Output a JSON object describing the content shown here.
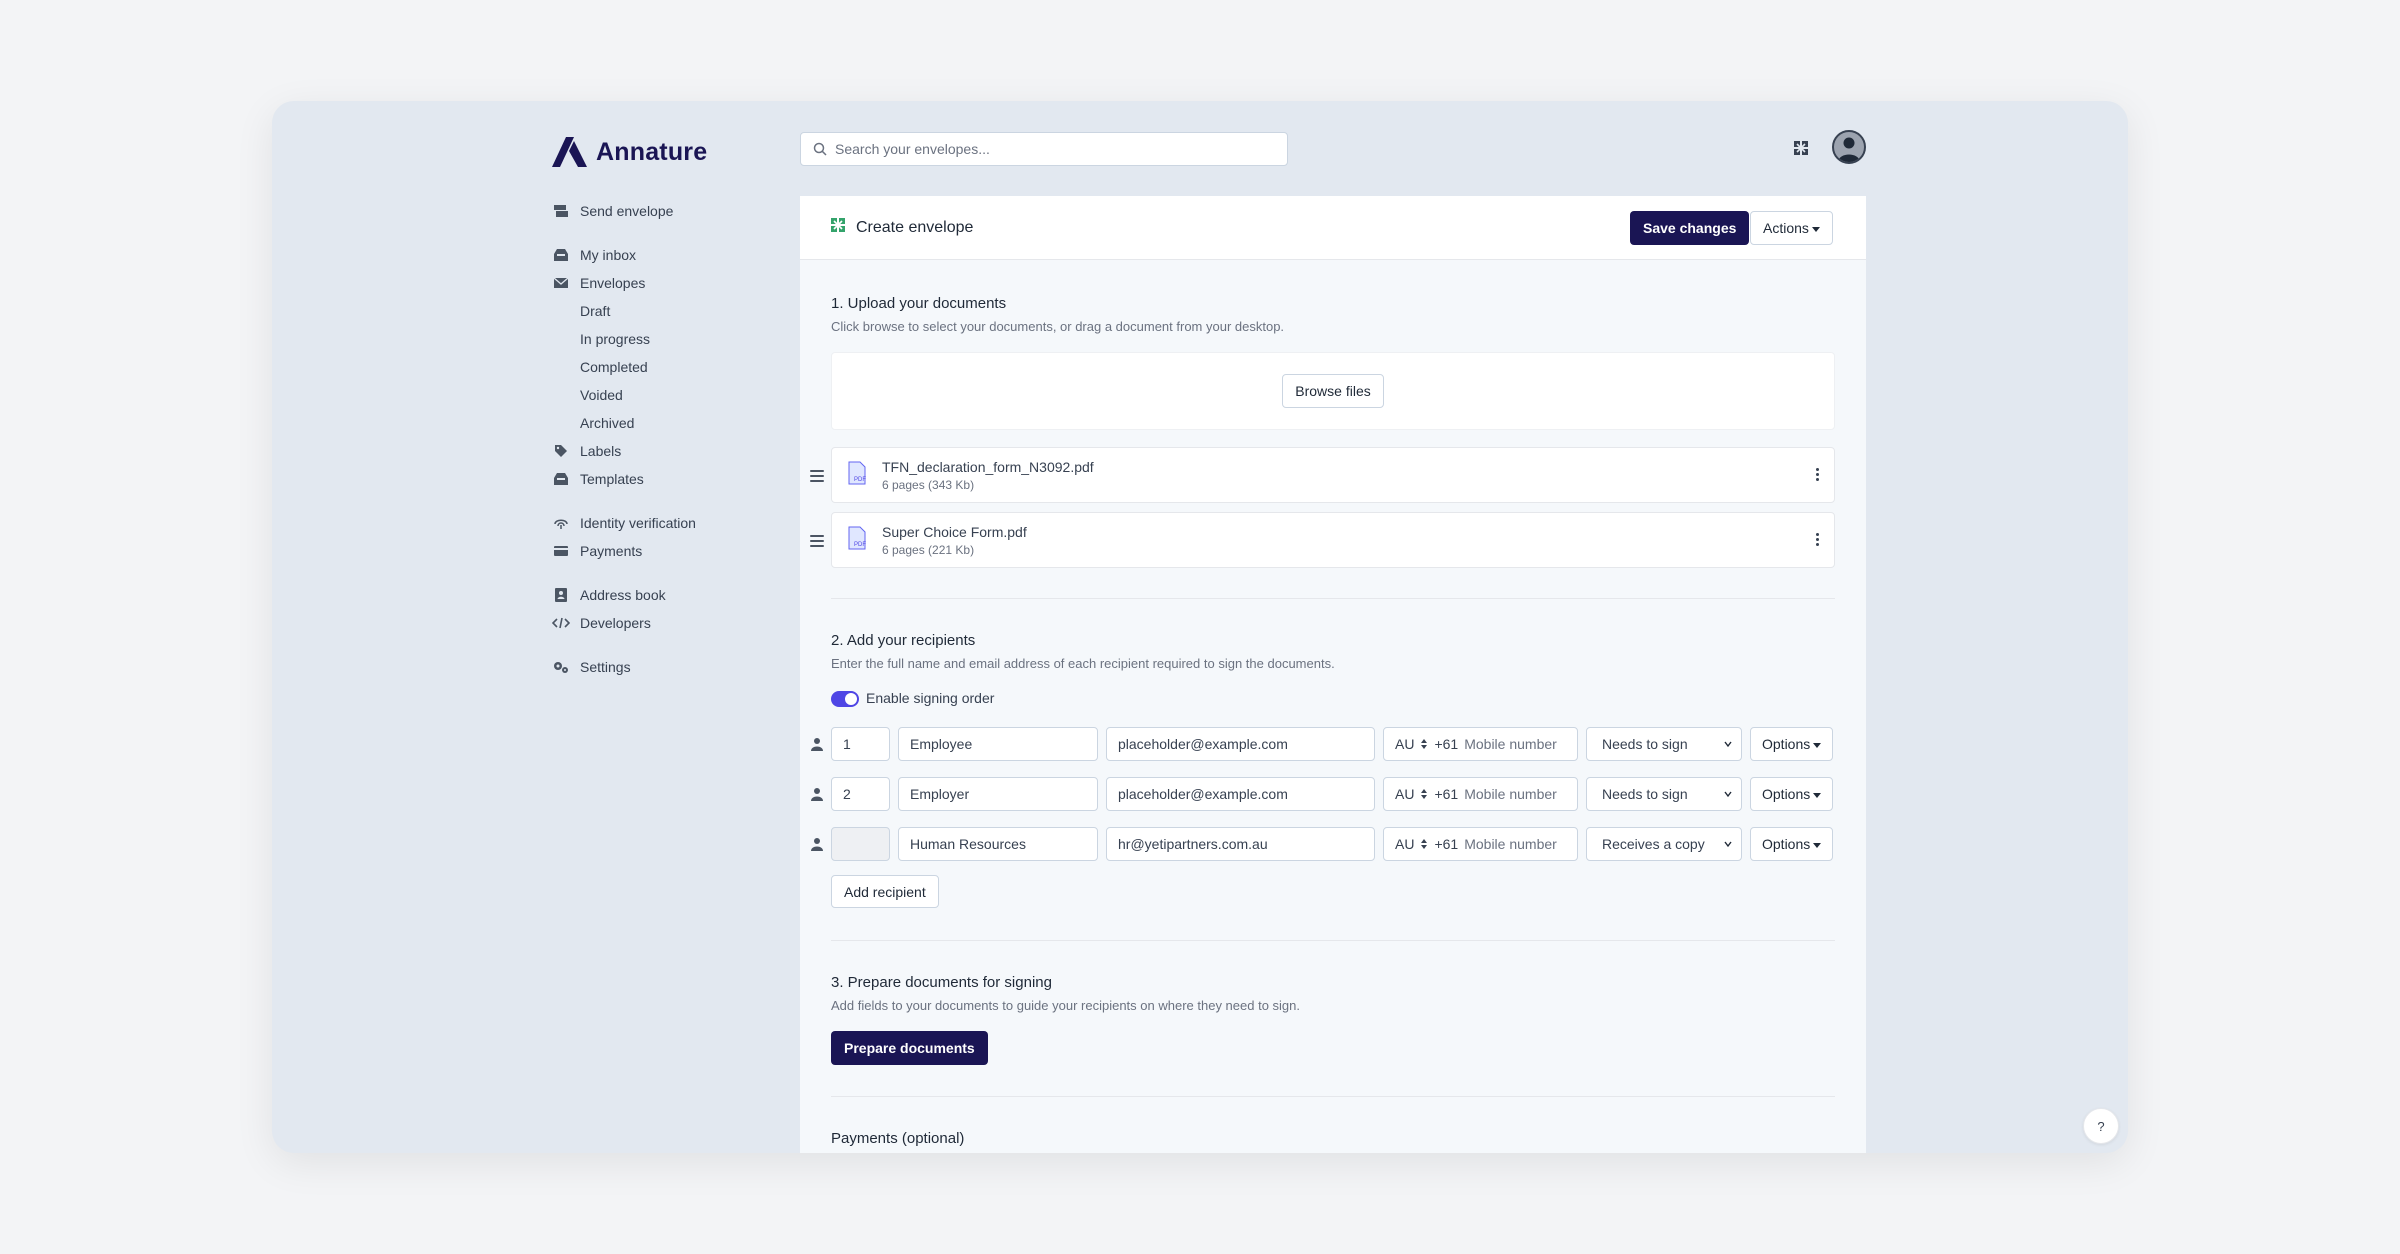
{
  "brand": {
    "name": "Annature",
    "color": "#1a1554"
  },
  "search": {
    "placeholder": "Search your envelopes..."
  },
  "sidebar": {
    "send_envelope": "Send envelope",
    "my_inbox": "My inbox",
    "envelopes": "Envelopes",
    "envelope_children": [
      "Draft",
      "In progress",
      "Completed",
      "Voided",
      "Archived"
    ],
    "labels": "Labels",
    "templates": "Templates",
    "identity_verification": "Identity verification",
    "payments": "Payments",
    "address_book": "Address book",
    "developers": "Developers",
    "settings": "Settings"
  },
  "header": {
    "title": "Create envelope",
    "save_label": "Save changes",
    "actions_label": "Actions"
  },
  "upload": {
    "title": "1. Upload your documents",
    "description": "Click browse to select your documents, or drag a document from your desktop.",
    "browse_label": "Browse files",
    "documents": [
      {
        "name": "TFN_declaration_form_N3092.pdf",
        "meta": "6 pages (343 Kb)",
        "icon_label": "PDF"
      },
      {
        "name": "Super Choice Form.pdf",
        "meta": "6 pages (221 Kb)",
        "icon_label": "PDF"
      }
    ]
  },
  "recipients": {
    "title": "2. Add your recipients",
    "description": "Enter the full name and email address of each recipient required to sign the documents.",
    "signing_order_label": "Enable signing order",
    "signing_order_enabled": true,
    "rows": [
      {
        "order": "1",
        "name": "Employee",
        "email": "placeholder@example.com",
        "country": "AU",
        "dial": "+61",
        "mobile_placeholder": "Mobile number",
        "role": "Needs to sign",
        "options_label": "Options"
      },
      {
        "order": "2",
        "name": "Employer",
        "email": "placeholder@example.com",
        "country": "AU",
        "dial": "+61",
        "mobile_placeholder": "Mobile number",
        "role": "Needs to sign",
        "options_label": "Options"
      },
      {
        "order": "",
        "name": "Human Resources",
        "email": "hr@yetipartners.com.au",
        "country": "AU",
        "dial": "+61",
        "mobile_placeholder": "Mobile number",
        "role": "Receives a copy",
        "options_label": "Options"
      }
    ],
    "add_label": "Add recipient"
  },
  "prepare": {
    "title": "3. Prepare documents for signing",
    "description": "Add fields to your documents to guide your recipients on where they need to sign.",
    "button_label": "Prepare documents"
  },
  "payments": {
    "title": "Payments (optional)"
  },
  "help": {
    "label": "?"
  },
  "colors": {
    "primary": "#1a1554",
    "toggle": "#4f46e5",
    "accent_green": "#34a36b"
  }
}
